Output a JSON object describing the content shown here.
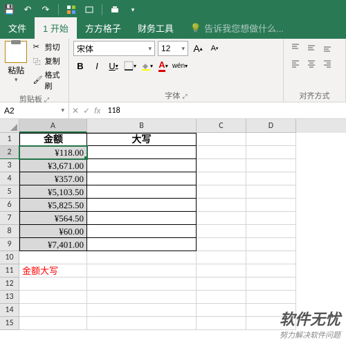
{
  "qat": {
    "save": "💾",
    "undo": "↶",
    "redo": "↷"
  },
  "tabs": {
    "file": "文件",
    "home": "1 开始",
    "ffgz": "方方格子",
    "finance": "财务工具",
    "tell": "告诉我您想做什么..."
  },
  "ribbon": {
    "clipboard": {
      "label": "剪贴板",
      "paste": "粘贴",
      "cut": "剪切",
      "copy": "复制",
      "format": "格式刷"
    },
    "font": {
      "label": "字体",
      "name": "宋体",
      "size": "12",
      "bold": "B",
      "italic": "I",
      "underline": "U",
      "increase": "A",
      "decrease": "A",
      "wen": "wén"
    },
    "align": {
      "label": "对齐方式"
    }
  },
  "fx": {
    "name": "A2",
    "value": "118"
  },
  "cols": [
    "A",
    "B",
    "C",
    "D"
  ],
  "table": {
    "h1": "金额",
    "h2": "大写",
    "amounts": [
      "¥118.00",
      "¥3,671.00",
      "¥357.00",
      "¥5,103.50",
      "¥5,825.50",
      "¥564.50",
      "¥60.00",
      "¥7,401.00"
    ],
    "note": "金额大写"
  },
  "watermark": {
    "big": "软件无忧",
    "small": "努力解决软件问题"
  },
  "chart_data": {
    "type": "table",
    "title": "金额",
    "columns": [
      "金额",
      "大写"
    ],
    "values": [
      118.0,
      3671.0,
      357.0,
      5103.5,
      5825.5,
      564.5,
      60.0,
      7401.0
    ]
  }
}
